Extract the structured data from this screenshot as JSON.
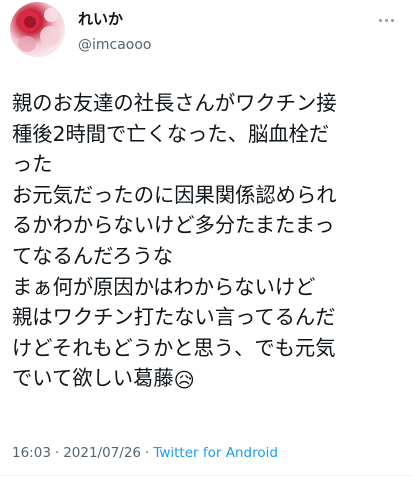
{
  "user": {
    "display_name": "れいか",
    "handle": "@imcaooo"
  },
  "tweet": {
    "lines": [
      "親のお友達の社長さんがワクチン接",
      "種後2時間で亡くなった、脳血栓だ",
      "った",
      "お元気だったのに因果関係認められ",
      "るかわからないけど多分たまたまっ",
      "てなるんだろうな",
      "まぁ何が原因かはわからないけど",
      "親はワクチン打たない言ってるんだ",
      "けどそれもどうかと思う、でも元気",
      "でいて欲しい葛藤"
    ],
    "emoji": "😥"
  },
  "meta": {
    "time": "16:03",
    "date": "2021/07/26",
    "separator": "·",
    "source": "Twitter for Android"
  },
  "icons": {
    "more": "more-options-icon",
    "avatar": "rose-avatar"
  }
}
